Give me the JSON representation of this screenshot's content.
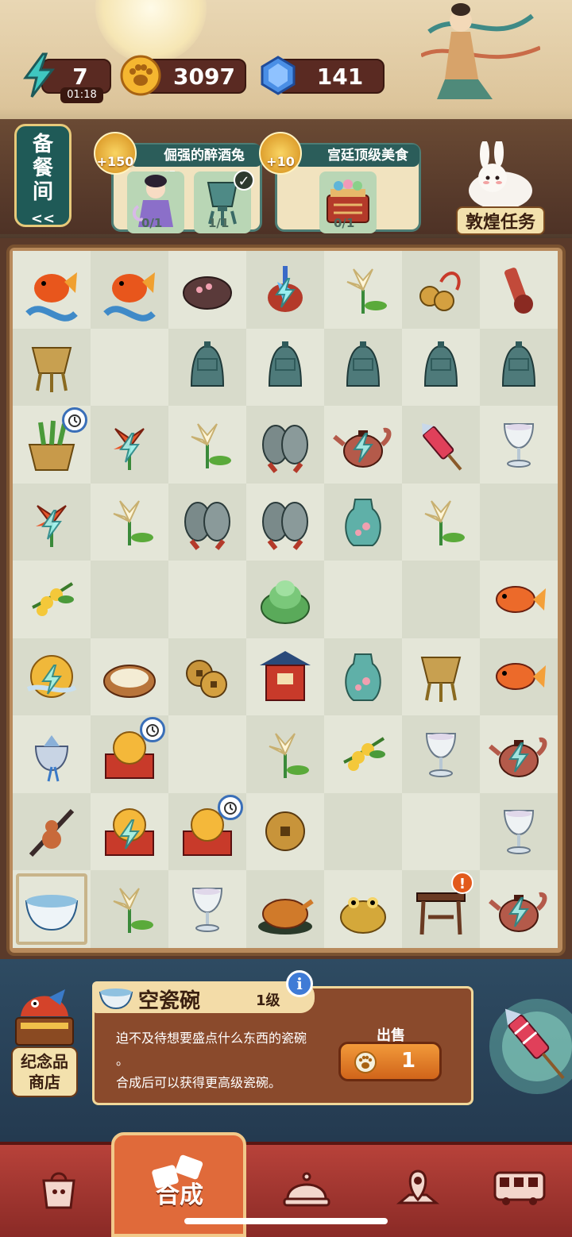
{
  "resources": {
    "energy": "7",
    "energy_timer": "01:18",
    "coins": "3097",
    "gems": "141"
  },
  "kitchen_button": {
    "label_line1": "备",
    "label_line2": "餐",
    "label_line3": "间",
    "arrow": "<<"
  },
  "orders": [
    {
      "title": "倔强的醉酒兔叽",
      "reward": "+150",
      "slots": [
        {
          "icon": "fairy-doll-icon",
          "count": "0/1"
        },
        {
          "icon": "bronze-vessel-icon",
          "count": "1/1",
          "done": true
        }
      ]
    },
    {
      "title": "宫廷顶级美食",
      "reward": "+10",
      "slots": [
        {
          "icon": "food-basket-icon",
          "count": "0/1"
        }
      ]
    }
  ],
  "dunhuang_task": {
    "label": "敦煌任务"
  },
  "board": {
    "rows": [
      [
        "koi-wave-icon",
        "koi-wave-icon",
        "ocarina-icon",
        "pipa-lute-icon",
        "lily-flower-icon",
        "coin-string-icon",
        "red-instrument-icon"
      ],
      [
        "bronze-vessel-icon",
        "",
        "bronze-bell-icon",
        "bronze-bell-icon",
        "bronze-bell-icon",
        "bronze-bell-icon",
        "bronze-bell-icon"
      ],
      [
        "vegetable-basket-icon",
        "tiger-lily-icon",
        "lily-flower-icon",
        "cymbals-icon",
        "teapot-icon",
        "firework-rocket-icon",
        "glass-goblet-icon"
      ],
      [
        "tiger-lily-icon",
        "lily-flower-icon",
        "cymbals-icon",
        "cymbals-icon",
        "porcelain-vase-icon",
        "lily-flower-icon",
        ""
      ],
      [
        "osmanthus-icon",
        "",
        "",
        "cabbage-icon",
        "",
        "",
        "goldfish-icon"
      ],
      [
        "golden-orb-icon",
        "rice-basket-icon",
        "copper-coins-icon",
        "pavilion-icon",
        "porcelain-vase-icon",
        "bronze-vessel-icon",
        "goldfish-icon"
      ],
      [
        "silk-pouch-icon",
        "gold-ingot-box-icon",
        "",
        "lily-flower-icon",
        "osmanthus-icon",
        "glass-goblet-icon",
        "teapot-icon"
      ],
      [
        "gourd-staff-icon",
        "gold-ingot-box-icon",
        "gold-ingot-box-icon",
        "copper-coin-icon",
        "",
        "",
        "glass-goblet-icon"
      ],
      [
        "porcelain-bowl-icon",
        "lily-flower-icon",
        "glass-goblet-icon",
        "roast-duck-icon",
        "golden-toad-icon",
        "wooden-stool-icon",
        "teapot-icon"
      ]
    ]
  },
  "selected_item": {
    "name": "空瓷碗",
    "level": "1级",
    "description_line1": "迫不及待想要盛点什么东西的瓷碗",
    "description_line2": "。",
    "description_line3": "合成后可以获得更高级瓷碗。",
    "sell_label": "出售",
    "sell_price": "1"
  },
  "shop": {
    "label_line1": "纪念品",
    "label_line2": "商店"
  },
  "nav": {
    "active_label": "合成",
    "items": [
      "bag-icon",
      "merge-icon",
      "cloche-icon",
      "map-pin-icon",
      "bus-icon"
    ]
  },
  "colors": {
    "accent": "#e06a3a",
    "teal": "#2b5d5a",
    "board_frame": "#7a5230"
  }
}
